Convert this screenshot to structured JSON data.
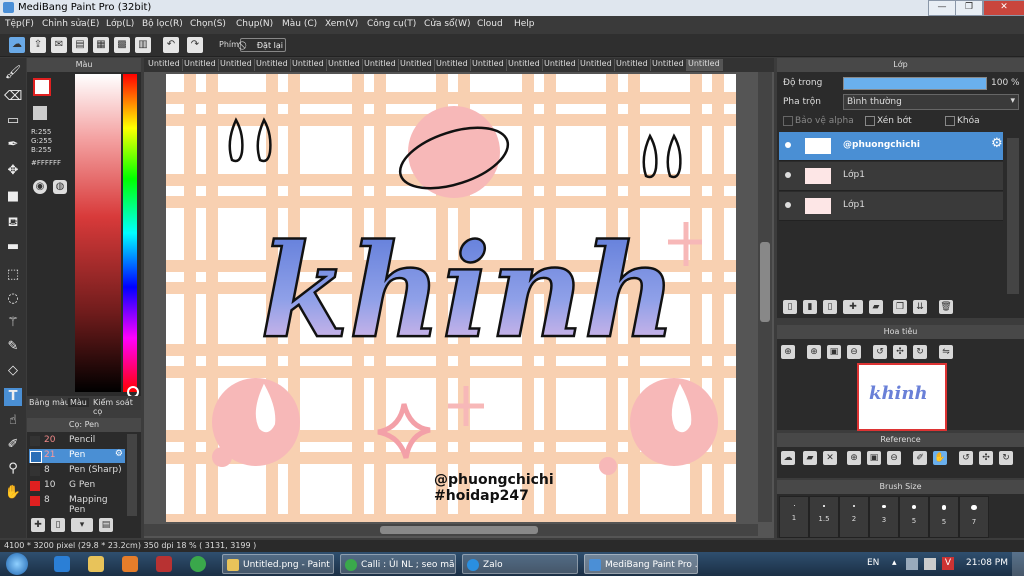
{
  "window": {
    "title": "MediBang Paint Pro (32bit)"
  },
  "menu": [
    "Tệp(F)",
    "Chỉnh sửa(E)",
    "Lớp(L)",
    "Bộ lọc(R)",
    "Chọn(S)",
    "Chụp(N)",
    "Màu (C)",
    "Xem(V)",
    "Công cụ(T)",
    "Cửa sổ(W)",
    "Cloud",
    "Help"
  ],
  "toolbar": {
    "phim_label": "Phím",
    "reset_label": "Đặt lại"
  },
  "color_panel": {
    "title": "Màu",
    "r": "R:255",
    "g": "G:255",
    "b": "B:255",
    "hex": "#FFFFFF"
  },
  "panel_tabs": [
    "Bảng màu",
    "Màu",
    "Kiểm soát cọ"
  ],
  "brush_panel": {
    "title": "Cọ: Pen",
    "items": [
      {
        "size": "20",
        "name": "Pencil",
        "color": "#333333"
      },
      {
        "size": "21",
        "name": "Pen",
        "color": "#2a6fb8",
        "selected": true
      },
      {
        "size": "8",
        "name": "Pen (Sharp)",
        "color": "#333333"
      },
      {
        "size": "10",
        "name": "G Pen",
        "color": "#e02020"
      },
      {
        "size": "8",
        "name": "Mapping Pen",
        "color": "#e02020"
      }
    ]
  },
  "doc_tabs": [
    "Untitled",
    "Untitled",
    "Untitled",
    "Untitled",
    "Untitled",
    "Untitled",
    "Untitled",
    "Untitled",
    "Untitled",
    "Untitled",
    "Untitled",
    "Untitled",
    "Untitled",
    "Untitled",
    "Untitled",
    "Untitled"
  ],
  "artwork": {
    "word": "khinh",
    "handle": "@phuongchichi",
    "tag": "#hoidap247"
  },
  "layer_panel": {
    "title": "Lớp",
    "opacity_label": "Độ trong",
    "opacity_value": "100 %",
    "blend_label": "Pha trộn",
    "blend_value": "Bình thường",
    "protect_alpha": "Bảo vệ alpha",
    "clipping": "Xén bớt",
    "lock": "Khóa",
    "layers": [
      {
        "name": "@phuongchichi",
        "selected": true
      },
      {
        "name": "Lớp1"
      },
      {
        "name": "Lớp1"
      }
    ]
  },
  "navigator": {
    "title": "Hoa tiêu"
  },
  "reference": {
    "title": "Reference"
  },
  "brush_size": {
    "title": "Brush Size",
    "sizes": [
      "1",
      "1.5",
      "2",
      "3",
      "5",
      "5",
      "7"
    ]
  },
  "status": {
    "text": "4100 * 3200 pixel  (29.8 * 23.2cm)  350 dpi  18 %  ( 3131, 3199 )"
  },
  "taskbar": {
    "items": [
      "Untitled.png - Paint",
      "Calli : ỦI NL ; seo mã...",
      "Zalo",
      "MediBang Paint Pro ..."
    ],
    "lang": "EN",
    "clock": "21:08 PM"
  },
  "colors": {
    "accent": "#4a8fd4",
    "grid": "#f7c8a4",
    "pink": "#f7b8b8",
    "gradient_top": "#5a78d8",
    "gradient_bottom": "#f0c0e8"
  }
}
